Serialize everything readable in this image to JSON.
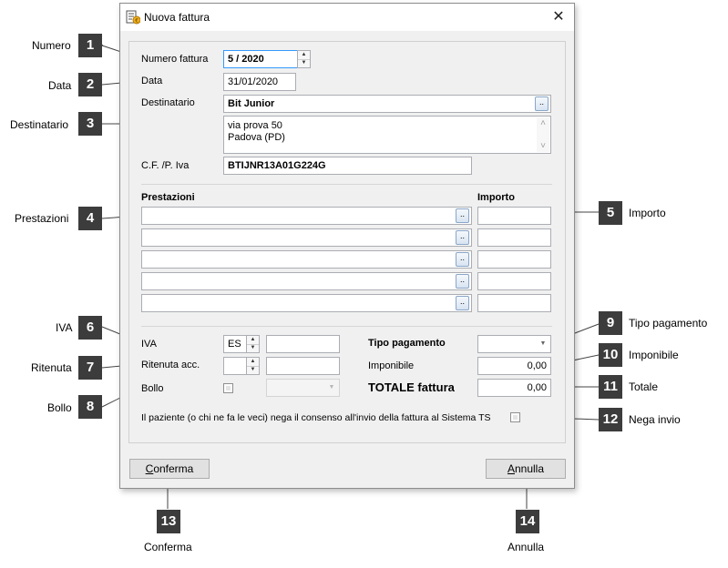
{
  "window": {
    "title": "Nuova fattura",
    "close_glyph": "✕",
    "icon": "invoice-app-icon"
  },
  "form": {
    "numero_label": "Numero fattura",
    "numero_value": "5 / 2020",
    "data_label": "Data",
    "data_value": "31/01/2020",
    "destinatario_label": "Destinatario",
    "destinatario_value": "Bit Junior",
    "browse_glyph": "..",
    "address_line1": "via prova 50",
    "address_line2": "Padova (PD)",
    "cf_label": "C.F. /P. Iva",
    "cf_value": "BTIJNR13A01G224G",
    "prestazioni_header": "Prestazioni",
    "importo_header": "Importo",
    "prestazioni_rows": [
      {
        "description": "",
        "amount": ""
      },
      {
        "description": "",
        "amount": ""
      },
      {
        "description": "",
        "amount": ""
      },
      {
        "description": "",
        "amount": ""
      },
      {
        "description": "",
        "amount": ""
      }
    ],
    "iva_label": "IVA",
    "iva_code": "ES",
    "iva_value": "",
    "ritenuta_label": "Ritenuta acc.",
    "ritenuta_code": "",
    "ritenuta_value": "",
    "bollo_label": "Bollo",
    "bollo_checked": false,
    "bollo_select": "",
    "tipo_pagamento_label": "Tipo pagamento",
    "tipo_pagamento_value": "",
    "imponibile_label": "Imponibile",
    "imponibile_value": "0,00",
    "totale_label": "TOTALE fattura",
    "totale_value": "0,00",
    "consenso_text": "Il paziente (o chi ne fa le veci) nega il consenso all'invio della fattura al Sistema TS",
    "consenso_checked": false
  },
  "buttons": {
    "conferma_first": "C",
    "conferma_rest": "onferma",
    "annulla_first": "A",
    "annulla_rest": "nnulla"
  },
  "callouts": [
    {
      "num": "1",
      "label": "Numero"
    },
    {
      "num": "2",
      "label": "Data"
    },
    {
      "num": "3",
      "label": "Destinatario"
    },
    {
      "num": "4",
      "label": "Prestazioni"
    },
    {
      "num": "5",
      "label": "Importo"
    },
    {
      "num": "6",
      "label": "IVA"
    },
    {
      "num": "7",
      "label": "Ritenuta"
    },
    {
      "num": "8",
      "label": "Bollo"
    },
    {
      "num": "9",
      "label": "Tipo pagamento"
    },
    {
      "num": "10",
      "label": "Imponibile"
    },
    {
      "num": "11",
      "label": "Totale"
    },
    {
      "num": "12",
      "label": "Nega invio"
    },
    {
      "num": "13",
      "label": "Conferma"
    },
    {
      "num": "14",
      "label": "Annulla"
    }
  ],
  "colors": {
    "badge": "#3c3c3c",
    "dialog_bg": "#f0f0f0",
    "focus_border": "#3399ff"
  }
}
